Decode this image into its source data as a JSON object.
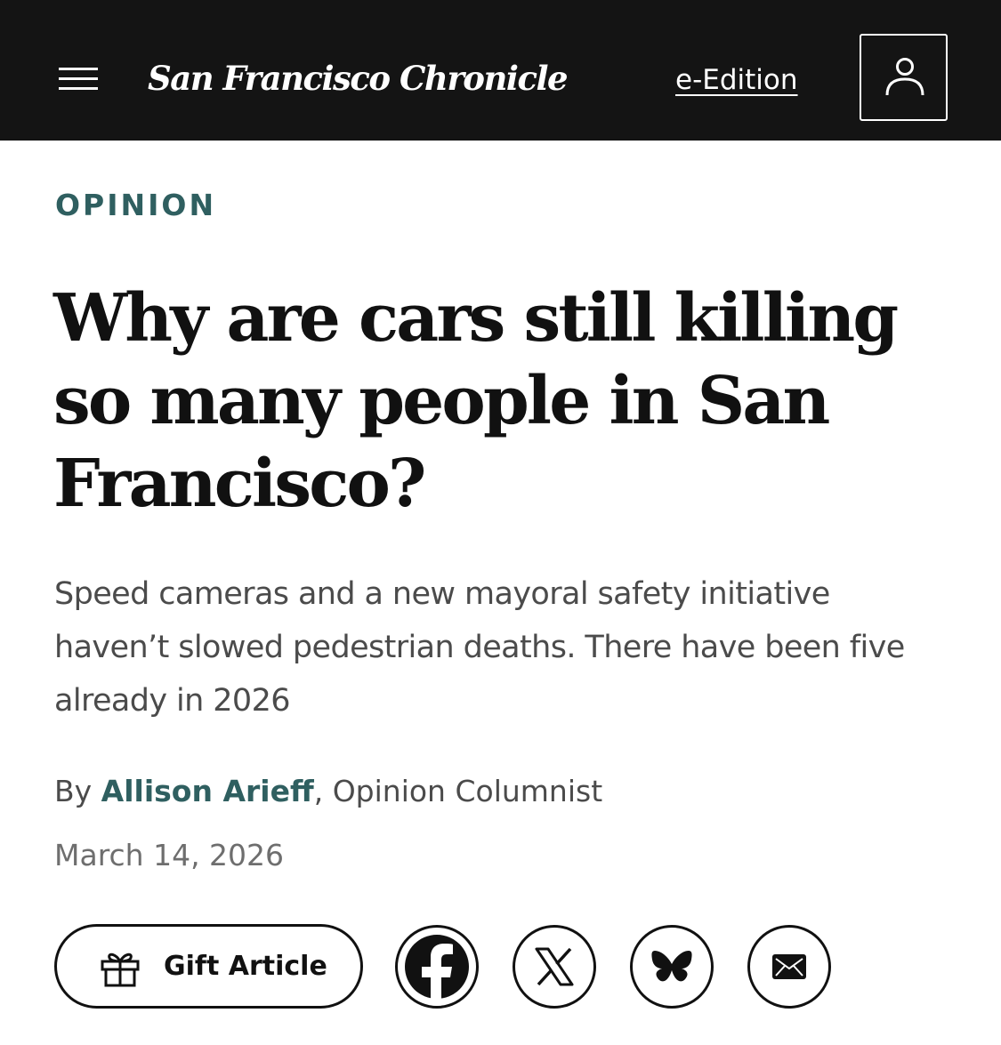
{
  "header": {
    "masthead": "San Francisco Chronicle",
    "e_edition_label": "e-Edition",
    "menu_icon": "hamburger-menu-icon",
    "account_icon": "user-account-icon",
    "background_color": "#141414"
  },
  "article": {
    "section_label": "OPINION",
    "headline": "Why are cars still killing so many people in San Francisco?",
    "dek": "Speed cameras and a new mayoral safety initiative haven’t slowed pedestrian deaths. There have been five already in 2026",
    "byline": {
      "prefix": "By",
      "author": "Allison Arieff",
      "separator": ",",
      "role": "Opinion Columnist"
    },
    "date": "March 14, 2026",
    "accent_color": "#2f5f60"
  },
  "share": {
    "gift_label": "Gift Article",
    "gift_icon": "gift-icon",
    "buttons": [
      {
        "name": "facebook",
        "icon": "facebook-icon"
      },
      {
        "name": "x",
        "icon": "x-icon"
      },
      {
        "name": "bluesky",
        "icon": "bluesky-butterfly-icon"
      },
      {
        "name": "email",
        "icon": "email-envelope-icon"
      }
    ]
  }
}
